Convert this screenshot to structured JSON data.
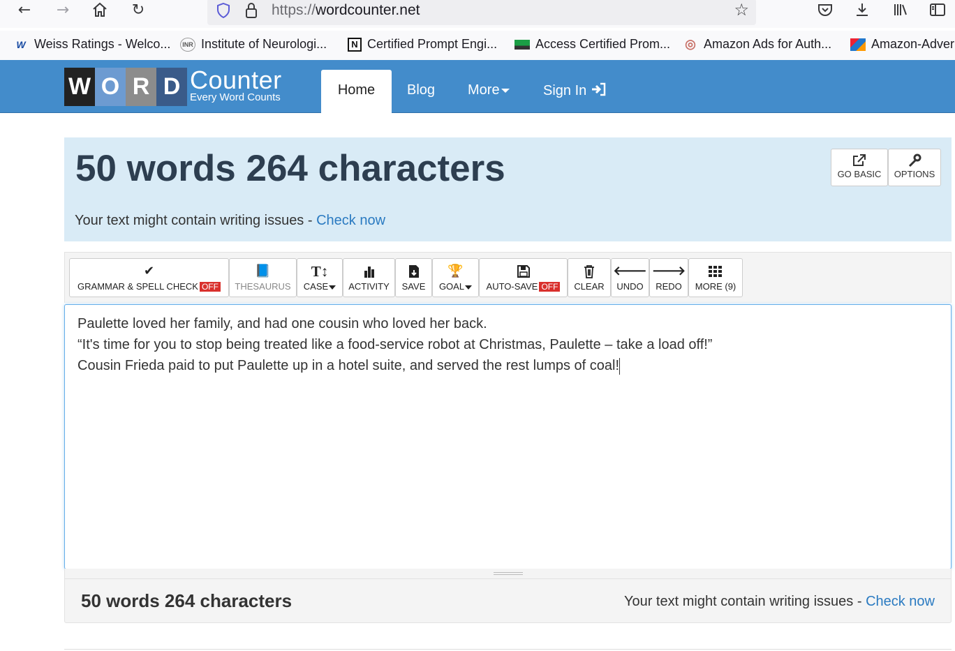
{
  "browser": {
    "url_scheme": "https://",
    "url_host": "wordcounter.net"
  },
  "bookmarks": [
    {
      "label": "Weiss Ratings - Welco...",
      "icon": "wr-icon",
      "fav": "W"
    },
    {
      "label": "Institute of Neurologi...",
      "icon": "inr-icon",
      "fav": "INR"
    },
    {
      "label": "Certified Prompt Engi...",
      "icon": "notion-icon",
      "fav": "N"
    },
    {
      "label": "Access Certified Prom...",
      "icon": "green-flag-icon",
      "fav": ""
    },
    {
      "label": "Amazon Ads for Auth...",
      "icon": "badge-icon",
      "fav": "◎"
    },
    {
      "label": "Amazon-Adver",
      "icon": "colorful-icon",
      "fav": ""
    }
  ],
  "site": {
    "logo_letters": [
      "W",
      "O",
      "R",
      "D"
    ],
    "logo_big": "Counter",
    "logo_small": "Every Word Counts",
    "nav": {
      "home": "Home",
      "blog": "Blog",
      "more": "More",
      "signin": "Sign In"
    }
  },
  "counter": {
    "title": "50 words 264 characters",
    "issues_text": "Your text might contain writing issues - ",
    "check_now": "Check now",
    "go_basic": "GO BASIC",
    "options": "OPTIONS"
  },
  "toolbar": {
    "grammar": "GRAMMAR & SPELL CHECK",
    "grammar_state": "OFF",
    "thesaurus": "THESAURUS",
    "case": "CASE",
    "activity": "ACTIVITY",
    "save": "SAVE",
    "goal": "GOAL",
    "autosave": "AUTO-SAVE",
    "autosave_state": "OFF",
    "clear": "CLEAR",
    "undo": "UNDO",
    "redo": "REDO",
    "more": "MORE (9)"
  },
  "editor": {
    "lines": [
      "Paulette loved her family, and had one cousin who loved her back.",
      "“It's time for you to stop being treated like a food-service robot at Christmas, Paulette – take a load off!”",
      "Cousin Frieda paid to put Paulette up in a hotel suite, and served the rest lumps of coal!"
    ]
  },
  "bottom": {
    "count": "50 words 264 characters",
    "issues_text": "Your text might contain writing issues - ",
    "check_now": "Check now"
  },
  "colors": {
    "header_blue": "#438ccb",
    "panel_blue": "#d9ebf6",
    "link": "#2a7ac1",
    "off_red": "#d9302c"
  }
}
